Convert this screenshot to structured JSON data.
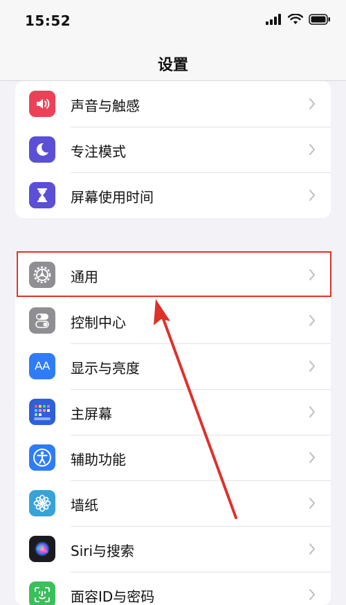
{
  "status": {
    "time": "15:52"
  },
  "nav": {
    "title": "设置"
  },
  "group1": {
    "items": [
      {
        "label": "声音与触感",
        "icon": "speaker-icon",
        "color": "#ec4157"
      },
      {
        "label": "专注模式",
        "icon": "moon-icon",
        "color": "#5b4fd6"
      },
      {
        "label": "屏幕使用时间",
        "icon": "hourglass-icon",
        "color": "#5b4fd6"
      }
    ]
  },
  "group2": {
    "items": [
      {
        "label": "通用",
        "icon": "gear-icon",
        "color": "#8e8e93"
      },
      {
        "label": "控制中心",
        "icon": "toggles-icon",
        "color": "#8e8e93"
      },
      {
        "label": "显示与亮度",
        "icon": "aa-icon",
        "color": "#2f7cf6"
      },
      {
        "label": "主屏幕",
        "icon": "home-grid-icon",
        "color": "#2f5fd9"
      },
      {
        "label": "辅助功能",
        "icon": "accessibility-icon",
        "color": "#2f7cf6"
      },
      {
        "label": "墙纸",
        "icon": "flower-icon",
        "color": "#36a3d9"
      },
      {
        "label": "Siri与搜索",
        "icon": "siri-icon",
        "color": "#1b1b1f"
      },
      {
        "label": "面容ID与密码",
        "icon": "faceid-icon",
        "color": "#3bbf5a"
      }
    ],
    "aa_text": "AA"
  },
  "annotation": {
    "color": "#e0302a"
  }
}
